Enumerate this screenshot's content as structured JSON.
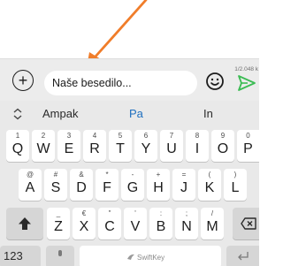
{
  "compose": {
    "text": "Naše besedilo...",
    "counter": "1/2.048 k"
  },
  "suggestions": [
    "Ampak",
    "Pa",
    "In"
  ],
  "keyboard": {
    "row1": [
      {
        "hint": "1",
        "key": "Q"
      },
      {
        "hint": "2",
        "key": "W"
      },
      {
        "hint": "3",
        "key": "E"
      },
      {
        "hint": "4",
        "key": "R"
      },
      {
        "hint": "5",
        "key": "T"
      },
      {
        "hint": "6",
        "key": "Y"
      },
      {
        "hint": "7",
        "key": "U"
      },
      {
        "hint": "8",
        "key": "I"
      },
      {
        "hint": "9",
        "key": "O"
      },
      {
        "hint": "0",
        "key": "P"
      }
    ],
    "row2": [
      {
        "hint": "@",
        "key": "A"
      },
      {
        "hint": "#",
        "key": "S"
      },
      {
        "hint": "&",
        "key": "D"
      },
      {
        "hint": "*",
        "key": "F"
      },
      {
        "hint": "-",
        "key": "G"
      },
      {
        "hint": "+",
        "key": "H"
      },
      {
        "hint": "=",
        "key": "J"
      },
      {
        "hint": "(",
        "key": "K"
      },
      {
        "hint": ")",
        "key": "L"
      }
    ],
    "row3": [
      {
        "hint": "_",
        "key": "Z"
      },
      {
        "hint": "€",
        "key": "X"
      },
      {
        "hint": "\"",
        "key": "C"
      },
      {
        "hint": "'",
        "key": "V"
      },
      {
        "hint": ":",
        "key": "B"
      },
      {
        "hint": ";",
        "key": "N"
      },
      {
        "hint": "/",
        "key": "M"
      }
    ],
    "numbers_label": "123",
    "space_brand": "SwiftKey"
  },
  "colors": {
    "arrow": "#f07d2a",
    "send": "#3cbc54",
    "suggestion_main": "#1e6fbf"
  },
  "icons": [
    "add-icon",
    "emoji-icon",
    "send-icon",
    "chevron-icon",
    "shift-icon",
    "backspace-icon",
    "microphone-icon",
    "enter-icon"
  ]
}
